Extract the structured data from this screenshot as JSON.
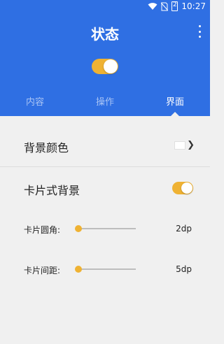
{
  "statusbar": {
    "time": "10:27",
    "battery": "2"
  },
  "header": {
    "title": "状态",
    "enabled": true
  },
  "tabs": [
    {
      "label": "内容",
      "active": false
    },
    {
      "label": "操作",
      "active": false
    },
    {
      "label": "界面",
      "active": true
    }
  ],
  "settings": {
    "background_color": {
      "label": "背景颜色",
      "value": "#ffffff"
    },
    "card_background": {
      "label": "卡片式背景",
      "enabled": true
    },
    "corner_radius": {
      "label": "卡片圆角:",
      "value": "2dp",
      "fraction": 0.0
    },
    "spacing": {
      "label": "卡片间距:",
      "value": "5dp",
      "fraction": 0.0
    }
  },
  "colors": {
    "primary": "#2f6fe3",
    "accent": "#efb233",
    "background": "#f0f0f0"
  }
}
